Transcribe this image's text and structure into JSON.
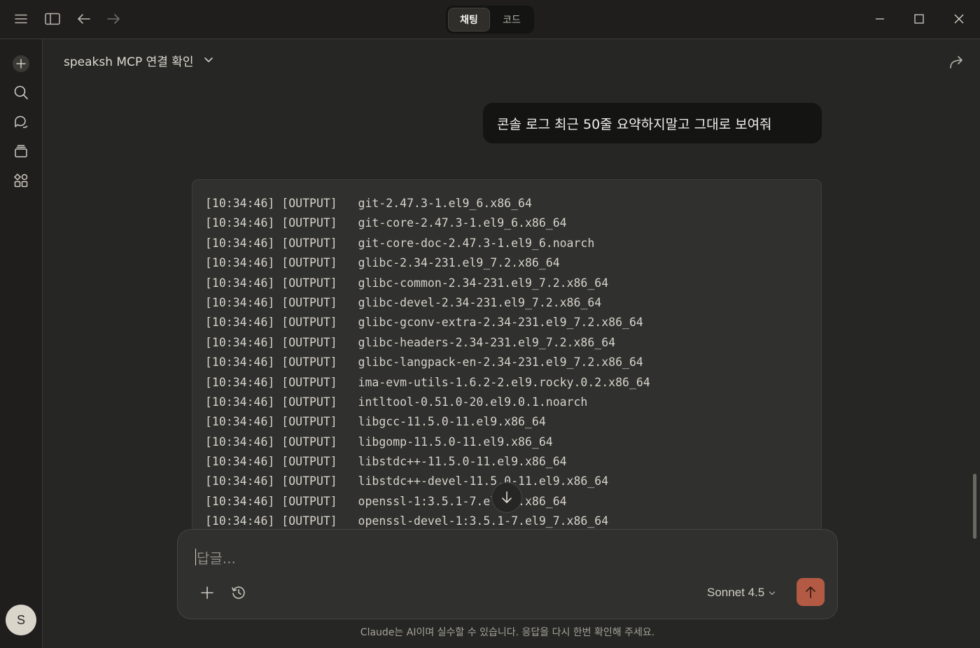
{
  "titlebar": {
    "modes": [
      {
        "label": "채팅",
        "active": true
      },
      {
        "label": "코드",
        "active": false
      }
    ],
    "icons": [
      "menu-icon",
      "sidebar-toggle-icon",
      "back-arrow-icon",
      "forward-arrow-icon",
      "minimize-icon",
      "maximize-icon",
      "close-icon"
    ]
  },
  "sidebar": {
    "items": [
      "new-chat",
      "search",
      "chats",
      "projects",
      "artifacts"
    ],
    "avatar_initial": "S"
  },
  "conversation": {
    "title": "speaksh MCP 연결 확인"
  },
  "user_message": "콘솔 로그 최근 50줄 요약하지말고 그대로 보여줘",
  "code_lines": [
    "[10:34:46] [OUTPUT]   git-2.47.3-1.el9_6.x86_64",
    "[10:34:46] [OUTPUT]   git-core-2.47.3-1.el9_6.x86_64",
    "[10:34:46] [OUTPUT]   git-core-doc-2.47.3-1.el9_6.noarch",
    "[10:34:46] [OUTPUT]   glibc-2.34-231.el9_7.2.x86_64",
    "[10:34:46] [OUTPUT]   glibc-common-2.34-231.el9_7.2.x86_64",
    "[10:34:46] [OUTPUT]   glibc-devel-2.34-231.el9_7.2.x86_64",
    "[10:34:46] [OUTPUT]   glibc-gconv-extra-2.34-231.el9_7.2.x86_64",
    "[10:34:46] [OUTPUT]   glibc-headers-2.34-231.el9_7.2.x86_64",
    "[10:34:46] [OUTPUT]   glibc-langpack-en-2.34-231.el9_7.2.x86_64",
    "[10:34:46] [OUTPUT]   ima-evm-utils-1.6.2-2.el9.rocky.0.2.x86_64",
    "[10:34:46] [OUTPUT]   intltool-0.51.0-20.el9.0.1.noarch",
    "[10:34:46] [OUTPUT]   libgcc-11.5.0-11.el9.x86_64",
    "[10:34:46] [OUTPUT]   libgomp-11.5.0-11.el9.x86_64",
    "[10:34:46] [OUTPUT]   libstdc++-11.5.0-11.el9.x86_64",
    "[10:34:46] [OUTPUT]   libstdc++-devel-11.5.0-11.el9.x86_64",
    "[10:34:46] [OUTPUT]   openssl-1:3.5.1-7.el9_7.x86_64",
    "[10:34:46] [OUTPUT]   openssl-devel-1:3.5.1-7.el9_7.x86_64"
  ],
  "composer": {
    "placeholder": "답글...",
    "model": "Sonnet 4.5"
  },
  "disclaimer": "Claude는 AI이며 실수할 수 있습니다. 응답을 다시 한번 확인해 주세요.",
  "colors": {
    "background": "#262624",
    "chrome": "#1f1e1d",
    "send_button": "#b25a43"
  }
}
